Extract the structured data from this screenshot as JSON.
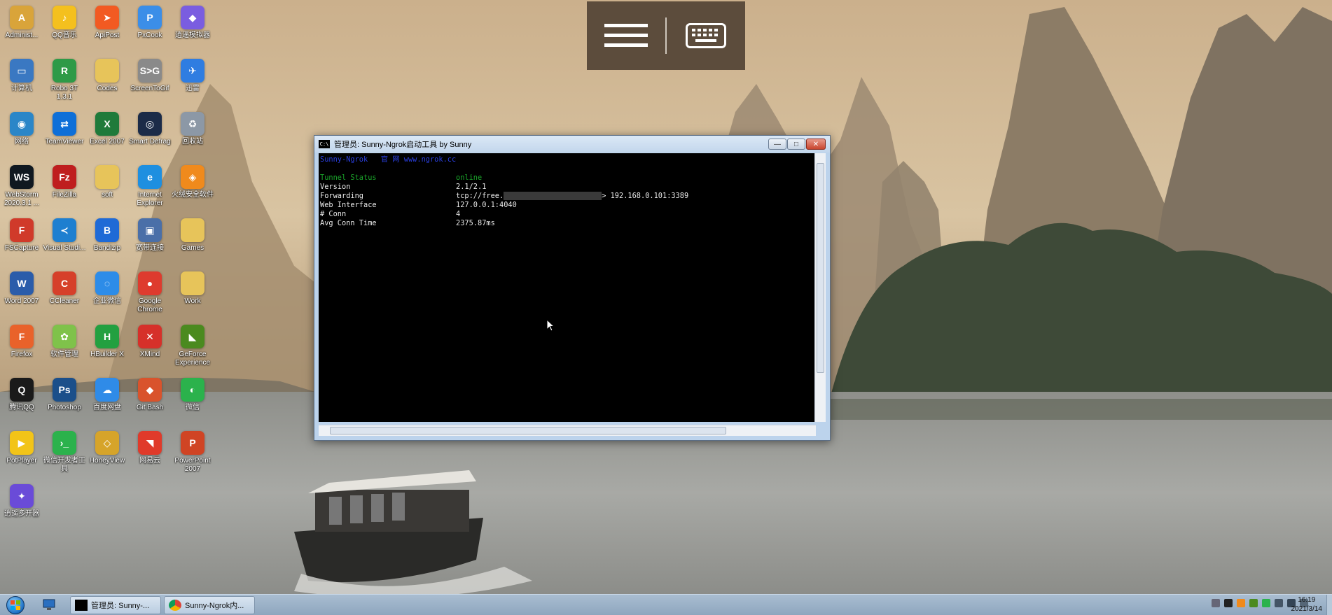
{
  "desktop": {
    "icons": [
      {
        "label": "Administ...",
        "icon": "user-folder-icon",
        "color": "#d9a43a",
        "glyph": "A"
      },
      {
        "label": "QQ音乐",
        "icon": "qq-music-icon",
        "color": "#f4c01e",
        "glyph": "♪"
      },
      {
        "label": "ApiPost",
        "icon": "apipost-icon",
        "color": "#f25a22",
        "glyph": "➤"
      },
      {
        "label": "PxCook",
        "icon": "pxcook-icon",
        "color": "#3b8ee8",
        "glyph": "P"
      },
      {
        "label": "逍遥模拟器",
        "icon": "emulator-icon",
        "color": "#7a5de0",
        "glyph": "◆"
      },
      {
        "label": "计算机",
        "icon": "computer-icon",
        "color": "#3a78c2",
        "glyph": "▭"
      },
      {
        "label": "Robo 3T 1.3.1",
        "icon": "robo3t-icon",
        "color": "#2e9a47",
        "glyph": "R"
      },
      {
        "label": "Codes",
        "icon": "folder-icon",
        "color": "#e7c45a",
        "glyph": ""
      },
      {
        "label": "ScreenToGif",
        "icon": "screentogif-icon",
        "color": "#8a8a8a",
        "glyph": "S>G"
      },
      {
        "label": "迅雷",
        "icon": "thunder-icon",
        "color": "#2f7de1",
        "glyph": "✈"
      },
      {
        "label": "网络",
        "icon": "network-icon",
        "color": "#2a86c8",
        "glyph": "◉"
      },
      {
        "label": "TeamViewer",
        "icon": "teamviewer-icon",
        "color": "#0e6fd8",
        "glyph": "⇄"
      },
      {
        "label": "Excel 2007",
        "icon": "excel-icon",
        "color": "#1f7a3a",
        "glyph": "X"
      },
      {
        "label": "Smart Defrag",
        "icon": "defrag-icon",
        "color": "#1b2b48",
        "glyph": "◎"
      },
      {
        "label": "回收站",
        "icon": "recycle-bin-icon",
        "color": "#8c98a6",
        "glyph": "♻"
      },
      {
        "label": "WebStorm 2020.3.1 ...",
        "icon": "webstorm-icon",
        "color": "#101820",
        "glyph": "WS"
      },
      {
        "label": "FileZilla",
        "icon": "filezilla-icon",
        "color": "#bf1e1e",
        "glyph": "Fz"
      },
      {
        "label": "soft",
        "icon": "folder-icon",
        "color": "#e7c45a",
        "glyph": ""
      },
      {
        "label": "Internet Explorer",
        "icon": "ie-icon",
        "color": "#1e8fe0",
        "glyph": "e"
      },
      {
        "label": "火绒安全软件",
        "icon": "huorong-icon",
        "color": "#f08a1c",
        "glyph": "◈"
      },
      {
        "label": "FSCapture",
        "icon": "fscapture-icon",
        "color": "#d03a2a",
        "glyph": "F"
      },
      {
        "label": "Visual Studi...",
        "icon": "vscode-icon",
        "color": "#1e7fd0",
        "glyph": "≺"
      },
      {
        "label": "Bandizip",
        "icon": "bandizip-icon",
        "color": "#1f6ad6",
        "glyph": "B"
      },
      {
        "label": "宽带连接",
        "icon": "broadband-icon",
        "color": "#4a6fa8",
        "glyph": "▣"
      },
      {
        "label": "Games",
        "icon": "folder-icon",
        "color": "#e7c45a",
        "glyph": ""
      },
      {
        "label": "Word 2007",
        "icon": "word-icon",
        "color": "#2a5caa",
        "glyph": "W"
      },
      {
        "label": "CCleaner",
        "icon": "ccleaner-icon",
        "color": "#d6402a",
        "glyph": "C"
      },
      {
        "label": "企业微信",
        "icon": "wecom-icon",
        "color": "#2d8ce8",
        "glyph": "◌"
      },
      {
        "label": "Google Chrome",
        "icon": "chrome-icon",
        "color": "#de3b2e",
        "glyph": "●"
      },
      {
        "label": "Work",
        "icon": "folder-icon",
        "color": "#e7c45a",
        "glyph": ""
      },
      {
        "label": "Firefox",
        "icon": "firefox-icon",
        "color": "#e9622a",
        "glyph": "F"
      },
      {
        "label": "软件管理",
        "icon": "software-manager-icon",
        "color": "#7fc24a",
        "glyph": "✿"
      },
      {
        "label": "HBuilder X",
        "icon": "hbuilder-icon",
        "color": "#23a040",
        "glyph": "H"
      },
      {
        "label": "XMind",
        "icon": "xmind-icon",
        "color": "#d6302a",
        "glyph": "✕"
      },
      {
        "label": "GeForce Experience",
        "icon": "geforce-icon",
        "color": "#4b8a1f",
        "glyph": "◣"
      },
      {
        "label": "腾讯QQ",
        "icon": "qq-icon",
        "color": "#1a1a1a",
        "glyph": "Q"
      },
      {
        "label": "Photoshop",
        "icon": "photoshop-icon",
        "color": "#1b4f8a",
        "glyph": "Ps"
      },
      {
        "label": "百度网盘",
        "icon": "baidu-netdisk-icon",
        "color": "#2f8be8",
        "glyph": "☁"
      },
      {
        "label": "Git Bash",
        "icon": "git-bash-icon",
        "color": "#d9532c",
        "glyph": "◆"
      },
      {
        "label": "微信",
        "icon": "wechat-icon",
        "color": "#2bb24c",
        "glyph": "◐"
      },
      {
        "label": "PotPlayer",
        "icon": "potplayer-icon",
        "color": "#f2c418",
        "glyph": "▶"
      },
      {
        "label": "微信开发者工具",
        "icon": "wechat-devtools-icon",
        "color": "#2bb24c",
        "glyph": "›_"
      },
      {
        "label": "HoneyView",
        "icon": "honeyview-icon",
        "color": "#d6a42a",
        "glyph": "◇"
      },
      {
        "label": "网易云",
        "icon": "netease-icon",
        "color": "#e03a2a",
        "glyph": "◥"
      },
      {
        "label": "PowerPoint 2007",
        "icon": "powerpoint-icon",
        "color": "#d04424",
        "glyph": "P"
      },
      {
        "label": "逍遥多开器",
        "icon": "multi-instance-icon",
        "color": "#6a4bd8",
        "glyph": "✦"
      }
    ]
  },
  "remote_toolbar": {
    "menu_icon": "hamburger-menu-icon",
    "keyboard_icon": "keyboard-icon"
  },
  "console": {
    "title": "管理员:  Sunny-Ngrok启动工具 by Sunny",
    "header": "Sunny-Ngrok   官 网 www.ngrok.cc",
    "rows": [
      {
        "key": "Tunnel Status",
        "value": "online"
      },
      {
        "key": "Version",
        "value": "2.1/2.1"
      },
      {
        "key": "Forwarding",
        "value_prefix": "tcp://free.",
        "value_suffix": "> 192.168.0.101:3389"
      },
      {
        "key": "Web Interface",
        "value": "127.0.0.1:4040"
      },
      {
        "key": "# Conn",
        "value": "4"
      },
      {
        "key": "Avg Conn Time",
        "value": "2375.87ms"
      }
    ],
    "buttons": {
      "minimize": "—",
      "maximize": "□",
      "close": "✕"
    }
  },
  "taskbar": {
    "items": [
      {
        "label": "管理员: Sunny-...",
        "icon": "cmd-icon"
      },
      {
        "label": "Sunny-Ngrok内...",
        "icon": "chrome-icon"
      }
    ],
    "clock_time": "16:19",
    "clock_date": "2021/3/14"
  }
}
